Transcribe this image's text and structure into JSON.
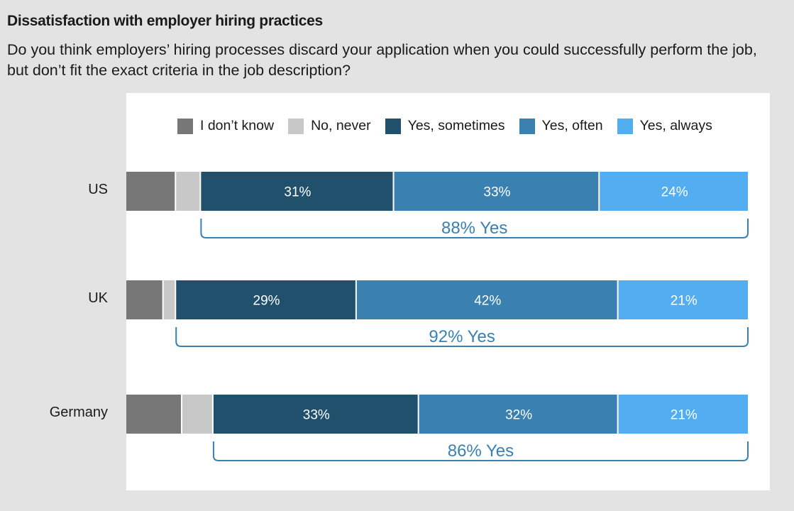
{
  "title": "Dissatisfaction with employer hiring practices",
  "subtitle": "Do you think employers’ hiring processes discard your application when you could successfully perform the job, but don’t fit the exact criteria in the job description?",
  "chart_data": {
    "type": "bar",
    "orientation": "horizontal-stacked",
    "title": "Dissatisfaction with employer hiring practices",
    "subtitle": "Do you think employers’ hiring processes discard your application when you could successfully perform the job, but don’t fit the exact criteria in the job description?",
    "xlabel": "",
    "ylabel": "",
    "xlim": [
      0,
      100
    ],
    "grid": false,
    "legend_position": "top",
    "categories": [
      "US",
      "UK",
      "Germany"
    ],
    "series": [
      {
        "name": "I don’t know",
        "color": "#777777",
        "values": [
          8,
          6,
          9
        ],
        "show_label": false
      },
      {
        "name": "No, never",
        "color": "#c8c8c8",
        "values": [
          4,
          2,
          5
        ],
        "show_label": false
      },
      {
        "name": "Yes, sometimes",
        "color": "#21506d",
        "values": [
          31,
          29,
          33
        ],
        "show_label": true
      },
      {
        "name": "Yes, often",
        "color": "#3a80b0",
        "values": [
          33,
          42,
          32
        ],
        "show_label": true
      },
      {
        "name": "Yes, always",
        "color": "#52aef0",
        "values": [
          24,
          21,
          21
        ],
        "show_label": true
      }
    ],
    "annotations": [
      {
        "category": "US",
        "text": "88% Yes",
        "value": 88
      },
      {
        "category": "UK",
        "text": "92% Yes",
        "value": 92
      },
      {
        "category": "Germany",
        "text": "86% Yes",
        "value": 86
      }
    ],
    "annotation_color": "#3a80b0"
  }
}
